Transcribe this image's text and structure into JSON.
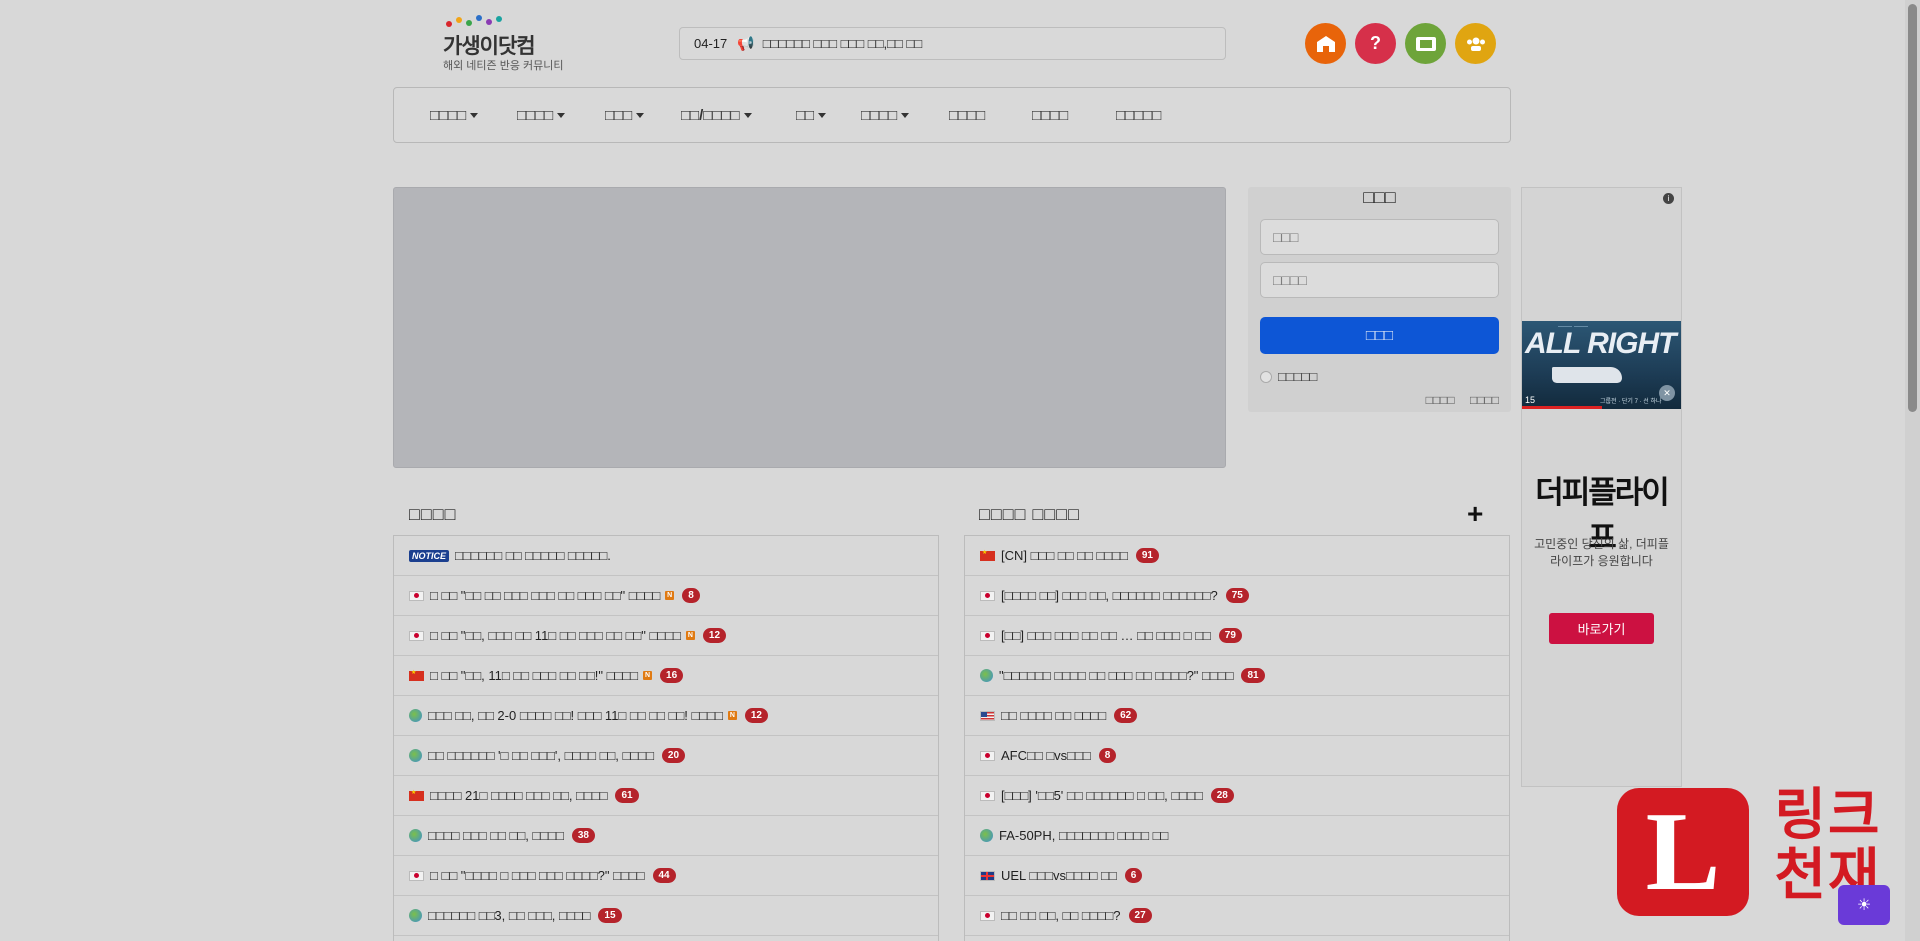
{
  "header": {
    "logo_title": "가생이닷컴",
    "logo_sub": "해외 네티즌 반응 커뮤니티",
    "ticker_date": "04-17",
    "ticker_text": "□□□□□□ □□□ □□□ □□,□□ □□",
    "icon_buttons": [
      {
        "name": "school-icon",
        "color": "#e8640a"
      },
      {
        "name": "help-icon",
        "color": "#d6304a"
      },
      {
        "name": "ticket-icon",
        "color": "#6ea43a"
      },
      {
        "name": "users-icon",
        "color": "#e0a511"
      }
    ]
  },
  "nav": {
    "items": [
      {
        "label": "□□□□",
        "dropdown": true
      },
      {
        "label": "□□□□",
        "dropdown": true
      },
      {
        "label": "□□□",
        "dropdown": true
      },
      {
        "label": "□□/□□□□",
        "dropdown": true
      },
      {
        "label": "□□",
        "dropdown": true
      },
      {
        "label": "□□□□",
        "dropdown": true
      },
      {
        "label": "□□□□",
        "dropdown": false
      },
      {
        "label": "□□□□",
        "dropdown": false
      },
      {
        "label": "□□□□□",
        "dropdown": false
      }
    ]
  },
  "login": {
    "title": "□□□",
    "id_placeholder": "□□□",
    "pw_placeholder": "□□□□",
    "submit_label": "□□□",
    "remember_label": "□□□□□",
    "link_1": "□□□□",
    "link_2": "□□□□",
    "accent": "#0d56d6"
  },
  "ad": {
    "info": "i",
    "video_big": "ALL RIGHT",
    "video_num": "15",
    "video_caption": "그룹전 · 단기 7 · 선 하나",
    "brand": "더피플라이프",
    "copy": "고민중인 당신의 삶, 더피플라이프가 응원합니다",
    "cta": "바로가기"
  },
  "sections": {
    "left_title": "□□□□",
    "right_title": "□□□□ □□□□",
    "plus": "+"
  },
  "left_list": [
    {
      "flag": "notice",
      "badge": "NOTICE",
      "text": "□□□□□□ □□ □□□□□ □□□□□.",
      "new": false,
      "count": ""
    },
    {
      "flag": "jp",
      "text": "□ □□ \"□□ □□ □□□ □□□ □□ □□□ □□\" □□□□",
      "new": true,
      "count": "8"
    },
    {
      "flag": "jp",
      "text": "□ □□ \"□□, □□□ □□ 11□ □□ □□□ □□ □□\" □□□□",
      "new": true,
      "count": "12"
    },
    {
      "flag": "cn",
      "text": "□ □□ \"□□, 11□ □□ □□□ □□ □□!\" □□□□",
      "new": true,
      "count": "16"
    },
    {
      "flag": "gl",
      "text": "□□□ □□, □□ 2-0 □□□□ □□! □□□ 11□ □□ □□ □□! □□□□",
      "new": true,
      "count": "12"
    },
    {
      "flag": "gl",
      "text": "□□ □□□□□□ '□ □□ □□□', □□□□ □□, □□□□",
      "new": false,
      "count": "20"
    },
    {
      "flag": "cn",
      "text": "□□□□ 21□ □□□□ □□□ □□, □□□□",
      "new": false,
      "count": "61"
    },
    {
      "flag": "gl",
      "text": "□□□□ □□□ □□ □□, □□□□",
      "new": false,
      "count": "38"
    },
    {
      "flag": "jp",
      "text": "□ □□ \"□□□□ □ □□□ □□□ □□□□?\" □□□□",
      "new": false,
      "count": "44"
    },
    {
      "flag": "gl",
      "text": "□□□□□□ □□3, □□ □□□, □□□□",
      "new": false,
      "count": "15"
    }
  ],
  "right_list": [
    {
      "flag": "cn",
      "text": "[CN] □□□ □□ □□ □□□□",
      "count": "91"
    },
    {
      "flag": "jp",
      "text": "[□□□□ □□] □□□ □□, □□□□□□ □□□□□□?",
      "count": "75"
    },
    {
      "flag": "jp",
      "text": "[□□] □□□ □□□ □□ □□ … □□ □□□ □ □□",
      "count": "79"
    },
    {
      "flag": "gl",
      "text": "\"□□□□□□ □□□□ □□ □□□ □□ □□□□?\" □□□□",
      "count": "81"
    },
    {
      "flag": "us",
      "text": "□□ □□□□ □□ □□□□",
      "count": "62"
    },
    {
      "flag": "jp",
      "text": "AFC□□ □vs□□□",
      "count": "8"
    },
    {
      "flag": "jp",
      "text": "[□□□] '□□5' □□ □□□□□□ □ □□, □□□□",
      "count": "28"
    },
    {
      "flag": "gl",
      "text": "FA-50PH, □□□□□□□ □□□□ □□",
      "count": ""
    },
    {
      "flag": "uk",
      "text": "UEL □□□vs□□□□ □□",
      "count": "6"
    },
    {
      "flag": "jp",
      "text": "□□ □□ □□, □□ □□□□?",
      "count": "27"
    }
  ],
  "overlay": {
    "brand_letter": "L",
    "brand_text": "링크천재",
    "float_icon": "☀"
  }
}
